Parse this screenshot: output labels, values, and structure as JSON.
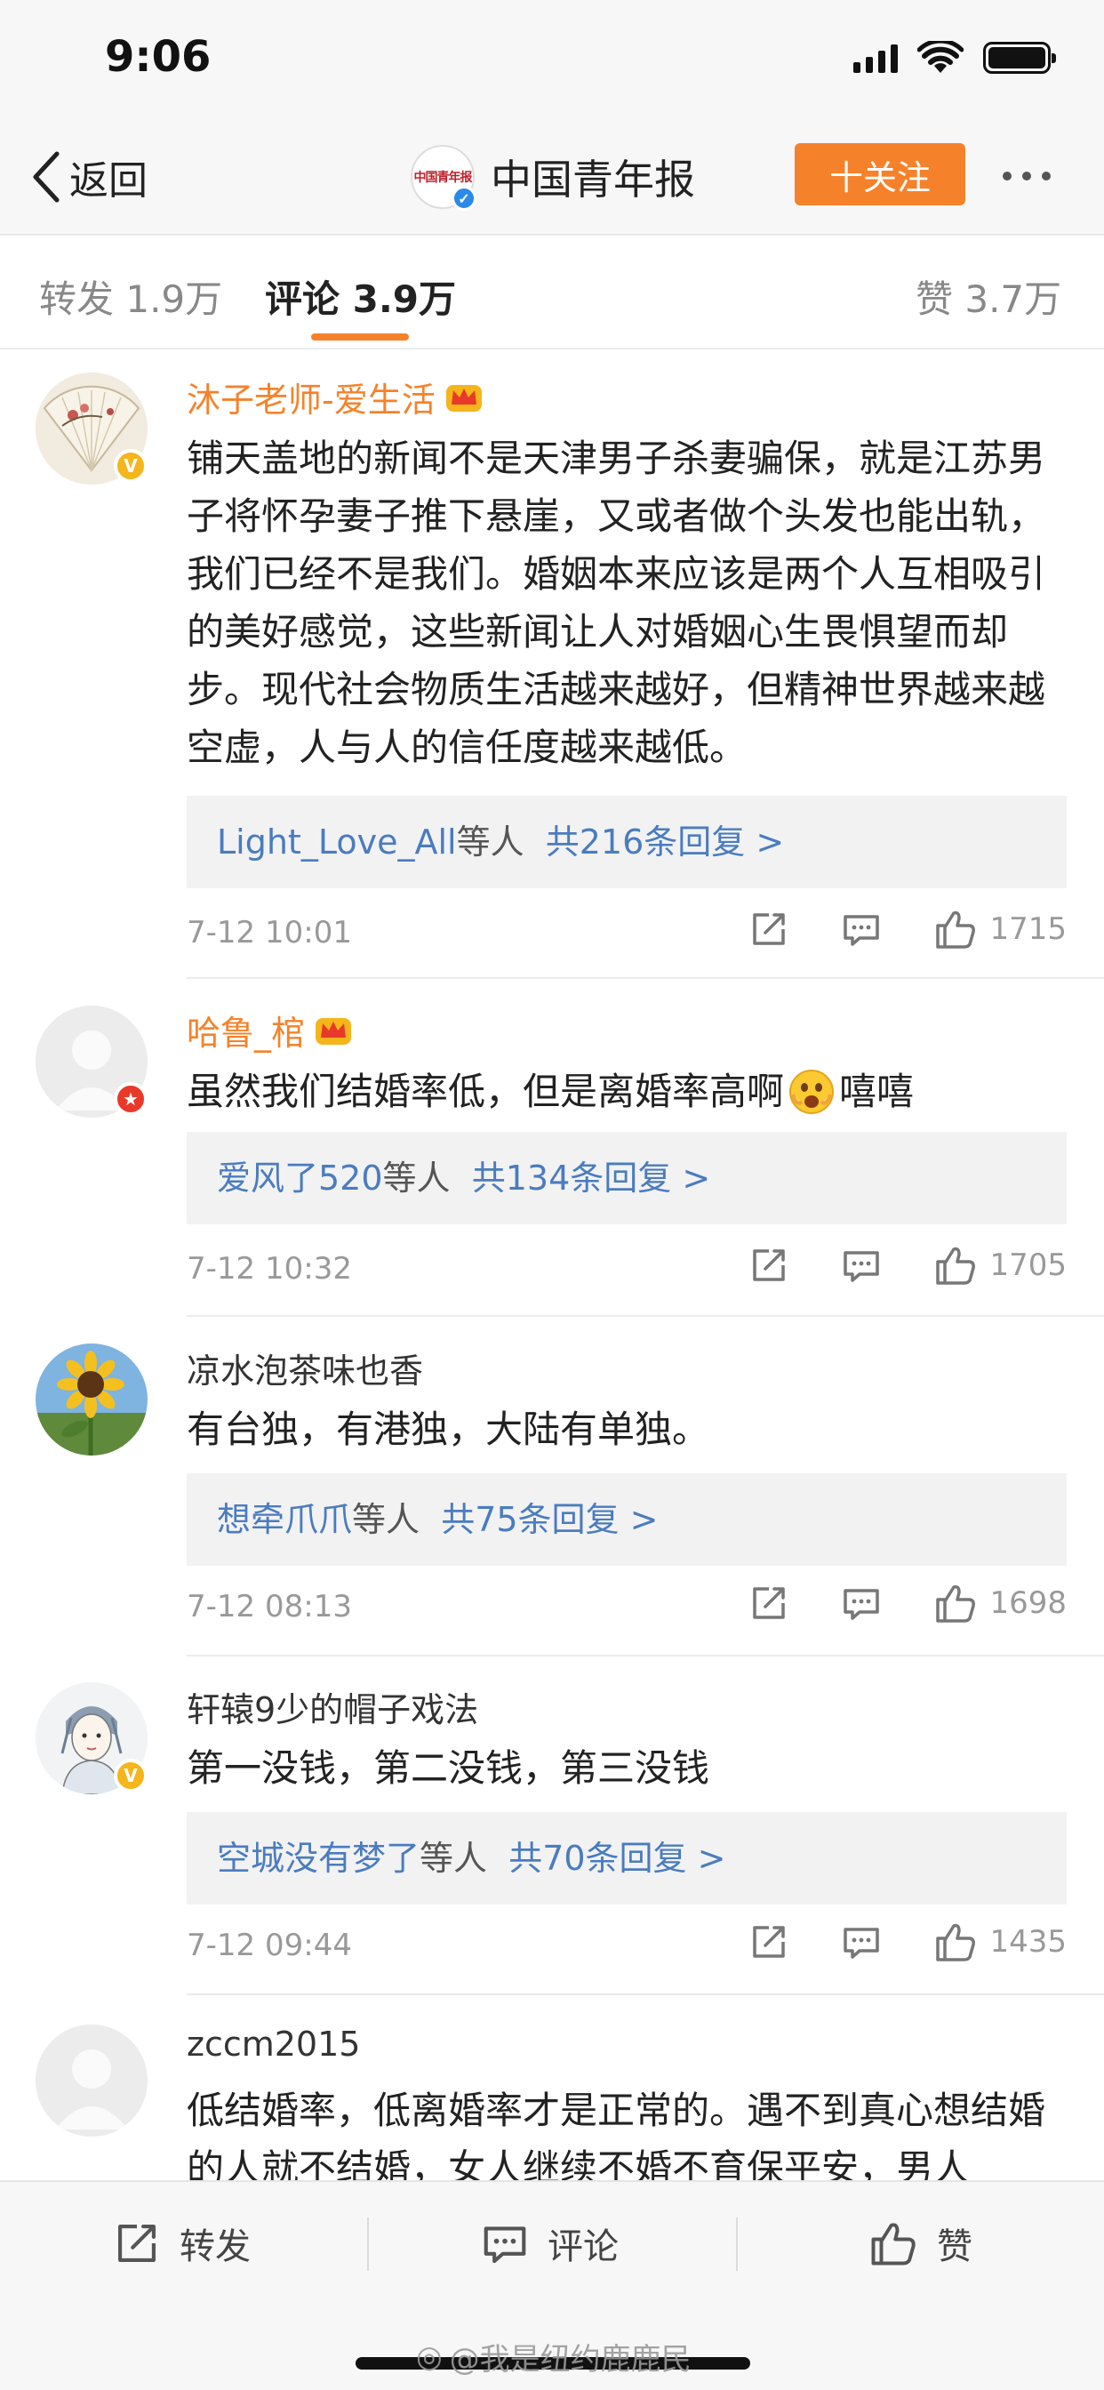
{
  "status_bar": {
    "time": "9:06"
  },
  "nav": {
    "back_label": "返回",
    "account_name": "中国青年报",
    "account_logo_text": "中国青年报",
    "follow_label": "十关注"
  },
  "tabs": {
    "repost": "转发 1.9万",
    "comments": "评论 3.9万",
    "likes": "赞 3.7万"
  },
  "comments": [
    {
      "name": "沐子老师-爱生活",
      "text": "铺天盖地的新闻不是天津男子杀妻骗保，就是江苏男子将怀孕妻子推下悬崖，又或者做个头发也能出轨，我们已经不是我们。婚姻本来应该是两个人互相吸引的美好感觉，这些新闻让人对婚姻心生畏惧望而却步。现代社会物质生活越来越好，但精神世界越来越空虚，人与人的信任度越来越低。",
      "reply_users": "Light_Love_All",
      "reply_suffix": "等人",
      "reply_total": "共216条回复 >",
      "time": "7-12 10:01",
      "likes": "1715"
    },
    {
      "name": "哈鲁_棺",
      "text": "虽然我们结婚率低，但是离婚率高啊",
      "text_after": "嘻嘻",
      "reply_users": "爱风了520",
      "reply_suffix": "等人",
      "reply_total": "共134条回复 >",
      "time": "7-12 10:32",
      "likes": "1705"
    },
    {
      "name": "凉水泡茶味也香",
      "text": "有台独，有港独，大陆有单独。",
      "reply_users": "想牵爪爪",
      "reply_suffix": "等人",
      "reply_total": "共75条回复 >",
      "time": "7-12 08:13",
      "likes": "1698"
    },
    {
      "name": "轩辕9少的帽子戏法",
      "text": "第一没钱，第二没钱，第三没钱",
      "reply_users": "空城没有梦了",
      "reply_suffix": "等人",
      "reply_total": "共70条回复 >",
      "time": "7-12 09:44",
      "likes": "1435"
    },
    {
      "name": "zccm2015",
      "text": "低结婚率，低离婚率才是正常的。遇不到真心想结婚的人就不结婚，女人继续不婚不育保平安，男人"
    }
  ],
  "bottom_bar": {
    "repost": "转发",
    "comment": "评论",
    "like": "赞",
    "watermark": "@我是纽约鹿鹿民"
  },
  "colors": {
    "accent_orange": "#f5822a",
    "vip_name": "#f5822a",
    "reply_blue": "#4a7cbf",
    "verify_yellow": "#f5b51b",
    "verify_red": "#e8392a"
  }
}
